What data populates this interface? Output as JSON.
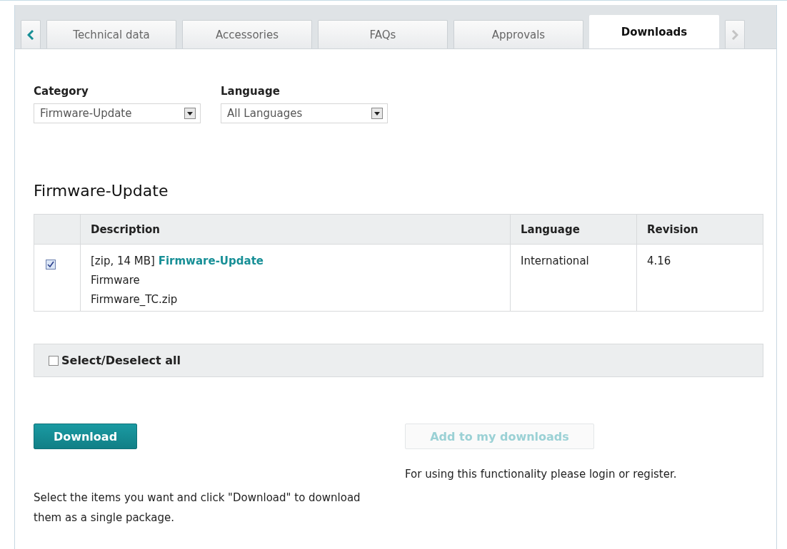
{
  "tabs": [
    {
      "label": "Technical data",
      "selected": false
    },
    {
      "label": "Accessories",
      "selected": false
    },
    {
      "label": "FAQs",
      "selected": false
    },
    {
      "label": "Approvals",
      "selected": false
    },
    {
      "label": "Downloads",
      "selected": true
    }
  ],
  "filters": [
    {
      "label": "Category",
      "value": "Firmware-Update"
    },
    {
      "label": "Language",
      "value": "All Languages"
    }
  ],
  "section_title": "Firmware-Update",
  "table": {
    "columns": [
      "Description",
      "Language",
      "Revision"
    ],
    "rows": [
      {
        "checked": true,
        "meta": "[zip, 14 MB]",
        "link": "Firmware-Update",
        "type": "Firmware",
        "file": "Firmware_TC.zip",
        "language": "International",
        "revision": "4.16"
      }
    ]
  },
  "select_all": {
    "label": "Select/Deselect all",
    "checked": false
  },
  "download_button": {
    "label": "Download",
    "disabled": false
  },
  "add_button": {
    "label": "Add to my downloads",
    "disabled": true
  },
  "login_note": "For using this functionality please login or register.",
  "help_text": "Select the items you want and click \"Download\" to download them as a single package."
}
